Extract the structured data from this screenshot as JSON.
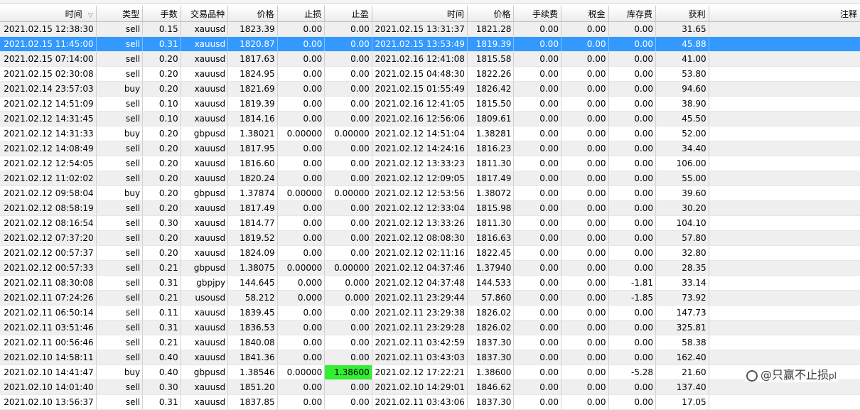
{
  "headers": {
    "open_time": "时间",
    "type": "类型",
    "volume": "手数",
    "symbol": "交易品种",
    "open_price": "价格",
    "stop_loss": "止损",
    "take_profit": "止盈",
    "close_time": "时间",
    "close_price": "价格",
    "commission": "手续费",
    "taxes": "税金",
    "swap": "库存费",
    "profit": "获利",
    "comment": "注释"
  },
  "sort_indicator": "▽",
  "selected_row": 1,
  "highlight": {
    "row": 23,
    "col": "tp",
    "color": "#33ee33"
  },
  "rows": [
    {
      "t1": "2021.02.15 12:38:30",
      "type": "sell",
      "vol": "0.15",
      "sym": "xauusd",
      "p1": "1823.39",
      "sl": "0.00",
      "tp": "0.00",
      "t2": "2021.02.15 13:31:37",
      "p2": "1821.28",
      "com": "0.00",
      "tax": "0.00",
      "swap": "0.00",
      "profit": "31.65"
    },
    {
      "t1": "2021.02.15 11:45:00",
      "type": "sell",
      "vol": "0.31",
      "sym": "xauusd",
      "p1": "1820.87",
      "sl": "0.00",
      "tp": "0.00",
      "t2": "2021.02.15 13:53:49",
      "p2": "1819.39",
      "com": "0.00",
      "tax": "0.00",
      "swap": "0.00",
      "profit": "45.88"
    },
    {
      "t1": "2021.02.15 07:14:00",
      "type": "sell",
      "vol": "0.20",
      "sym": "xauusd",
      "p1": "1817.63",
      "sl": "0.00",
      "tp": "0.00",
      "t2": "2021.02.16 12:41:08",
      "p2": "1815.58",
      "com": "0.00",
      "tax": "0.00",
      "swap": "0.00",
      "profit": "41.00"
    },
    {
      "t1": "2021.02.15 02:30:08",
      "type": "sell",
      "vol": "0.20",
      "sym": "xauusd",
      "p1": "1824.95",
      "sl": "0.00",
      "tp": "0.00",
      "t2": "2021.02.15 04:48:30",
      "p2": "1822.26",
      "com": "0.00",
      "tax": "0.00",
      "swap": "0.00",
      "profit": "53.80"
    },
    {
      "t1": "2021.02.14 23:57:03",
      "type": "buy",
      "vol": "0.20",
      "sym": "xauusd",
      "p1": "1821.69",
      "sl": "0.00",
      "tp": "0.00",
      "t2": "2021.02.15 01:55:49",
      "p2": "1826.42",
      "com": "0.00",
      "tax": "0.00",
      "swap": "0.00",
      "profit": "94.60"
    },
    {
      "t1": "2021.02.12 14:51:09",
      "type": "sell",
      "vol": "0.10",
      "sym": "xauusd",
      "p1": "1819.39",
      "sl": "0.00",
      "tp": "0.00",
      "t2": "2021.02.16 12:41:05",
      "p2": "1815.50",
      "com": "0.00",
      "tax": "0.00",
      "swap": "0.00",
      "profit": "38.90"
    },
    {
      "t1": "2021.02.12 14:31:45",
      "type": "sell",
      "vol": "0.10",
      "sym": "xauusd",
      "p1": "1814.16",
      "sl": "0.00",
      "tp": "0.00",
      "t2": "2021.02.16 12:56:06",
      "p2": "1809.61",
      "com": "0.00",
      "tax": "0.00",
      "swap": "0.00",
      "profit": "45.50"
    },
    {
      "t1": "2021.02.12 14:31:33",
      "type": "buy",
      "vol": "0.20",
      "sym": "gbpusd",
      "p1": "1.38021",
      "sl": "0.00000",
      "tp": "0.00000",
      "t2": "2021.02.12 14:51:04",
      "p2": "1.38281",
      "com": "0.00",
      "tax": "0.00",
      "swap": "0.00",
      "profit": "52.00"
    },
    {
      "t1": "2021.02.12 14:08:49",
      "type": "sell",
      "vol": "0.20",
      "sym": "xauusd",
      "p1": "1817.95",
      "sl": "0.00",
      "tp": "0.00",
      "t2": "2021.02.12 14:24:16",
      "p2": "1816.23",
      "com": "0.00",
      "tax": "0.00",
      "swap": "0.00",
      "profit": "34.40"
    },
    {
      "t1": "2021.02.12 12:54:05",
      "type": "sell",
      "vol": "0.20",
      "sym": "xauusd",
      "p1": "1816.60",
      "sl": "0.00",
      "tp": "0.00",
      "t2": "2021.02.12 13:33:23",
      "p2": "1811.30",
      "com": "0.00",
      "tax": "0.00",
      "swap": "0.00",
      "profit": "106.00"
    },
    {
      "t1": "2021.02.12 11:02:02",
      "type": "sell",
      "vol": "0.20",
      "sym": "xauusd",
      "p1": "1820.24",
      "sl": "0.00",
      "tp": "0.00",
      "t2": "2021.02.12 12:09:05",
      "p2": "1817.49",
      "com": "0.00",
      "tax": "0.00",
      "swap": "0.00",
      "profit": "55.00"
    },
    {
      "t1": "2021.02.12 09:58:04",
      "type": "buy",
      "vol": "0.20",
      "sym": "gbpusd",
      "p1": "1.37874",
      "sl": "0.00000",
      "tp": "0.00000",
      "t2": "2021.02.12 12:53:56",
      "p2": "1.38072",
      "com": "0.00",
      "tax": "0.00",
      "swap": "0.00",
      "profit": "39.60"
    },
    {
      "t1": "2021.02.12 08:58:19",
      "type": "sell",
      "vol": "0.20",
      "sym": "xauusd",
      "p1": "1817.49",
      "sl": "0.00",
      "tp": "0.00",
      "t2": "2021.02.12 12:33:04",
      "p2": "1815.98",
      "com": "0.00",
      "tax": "0.00",
      "swap": "0.00",
      "profit": "30.20"
    },
    {
      "t1": "2021.02.12 08:16:54",
      "type": "sell",
      "vol": "0.30",
      "sym": "xauusd",
      "p1": "1814.77",
      "sl": "0.00",
      "tp": "0.00",
      "t2": "2021.02.12 13:33:26",
      "p2": "1811.30",
      "com": "0.00",
      "tax": "0.00",
      "swap": "0.00",
      "profit": "104.10"
    },
    {
      "t1": "2021.02.12 07:37:20",
      "type": "sell",
      "vol": "0.20",
      "sym": "xauusd",
      "p1": "1819.52",
      "sl": "0.00",
      "tp": "0.00",
      "t2": "2021.02.12 08:08:30",
      "p2": "1816.63",
      "com": "0.00",
      "tax": "0.00",
      "swap": "0.00",
      "profit": "57.80"
    },
    {
      "t1": "2021.02.12 00:57:37",
      "type": "sell",
      "vol": "0.20",
      "sym": "xauusd",
      "p1": "1824.09",
      "sl": "0.00",
      "tp": "0.00",
      "t2": "2021.02.12 02:11:16",
      "p2": "1822.45",
      "com": "0.00",
      "tax": "0.00",
      "swap": "0.00",
      "profit": "32.80"
    },
    {
      "t1": "2021.02.12 00:57:33",
      "type": "sell",
      "vol": "0.21",
      "sym": "gbpusd",
      "p1": "1.38075",
      "sl": "0.00000",
      "tp": "0.00000",
      "t2": "2021.02.12 04:37:46",
      "p2": "1.37940",
      "com": "0.00",
      "tax": "0.00",
      "swap": "0.00",
      "profit": "28.35"
    },
    {
      "t1": "2021.02.11 08:30:08",
      "type": "sell",
      "vol": "0.31",
      "sym": "gbpjpy",
      "p1": "144.645",
      "sl": "0.000",
      "tp": "0.000",
      "t2": "2021.02.12 04:37:48",
      "p2": "144.533",
      "com": "0.00",
      "tax": "0.00",
      "swap": "-1.81",
      "profit": "33.14"
    },
    {
      "t1": "2021.02.11 07:24:26",
      "type": "sell",
      "vol": "0.21",
      "sym": "usousd",
      "p1": "58.212",
      "sl": "0.000",
      "tp": "0.000",
      "t2": "2021.02.11 23:29:44",
      "p2": "57.860",
      "com": "0.00",
      "tax": "0.00",
      "swap": "-1.85",
      "profit": "73.92"
    },
    {
      "t1": "2021.02.11 06:50:14",
      "type": "sell",
      "vol": "0.11",
      "sym": "xauusd",
      "p1": "1839.45",
      "sl": "0.00",
      "tp": "0.00",
      "t2": "2021.02.11 23:29:38",
      "p2": "1826.02",
      "com": "0.00",
      "tax": "0.00",
      "swap": "0.00",
      "profit": "147.73"
    },
    {
      "t1": "2021.02.11 03:51:46",
      "type": "sell",
      "vol": "0.31",
      "sym": "xauusd",
      "p1": "1836.53",
      "sl": "0.00",
      "tp": "0.00",
      "t2": "2021.02.11 23:29:28",
      "p2": "1826.02",
      "com": "0.00",
      "tax": "0.00",
      "swap": "0.00",
      "profit": "325.81"
    },
    {
      "t1": "2021.02.11 00:56:46",
      "type": "sell",
      "vol": "0.21",
      "sym": "xauusd",
      "p1": "1840.08",
      "sl": "0.00",
      "tp": "0.00",
      "t2": "2021.02.11 03:42:59",
      "p2": "1837.30",
      "com": "0.00",
      "tax": "0.00",
      "swap": "0.00",
      "profit": "58.38"
    },
    {
      "t1": "2021.02.10 14:58:11",
      "type": "sell",
      "vol": "0.40",
      "sym": "xauusd",
      "p1": "1841.36",
      "sl": "0.00",
      "tp": "0.00",
      "t2": "2021.02.11 03:43:03",
      "p2": "1837.30",
      "com": "0.00",
      "tax": "0.00",
      "swap": "0.00",
      "profit": "162.40"
    },
    {
      "t1": "2021.02.10 14:41:47",
      "type": "buy",
      "vol": "0.40",
      "sym": "gbpusd",
      "p1": "1.38546",
      "sl": "0.00000",
      "tp": "1.38600",
      "t2": "2021.02.12 17:22:21",
      "p2": "1.38600",
      "com": "0.00",
      "tax": "0.00",
      "swap": "-5.28",
      "profit": "21.60"
    },
    {
      "t1": "2021.02.10 14:01:40",
      "type": "sell",
      "vol": "0.30",
      "sym": "xauusd",
      "p1": "1851.20",
      "sl": "0.00",
      "tp": "0.00",
      "t2": "2021.02.10 14:29:01",
      "p2": "1846.62",
      "com": "0.00",
      "tax": "0.00",
      "swap": "0.00",
      "profit": "137.40"
    },
    {
      "t1": "2021.02.10 13:56:37",
      "type": "sell",
      "vol": "0.31",
      "sym": "xauusd",
      "p1": "1837.85",
      "sl": "0.00",
      "tp": "0.00",
      "t2": "2021.02.11 03:43:06",
      "p2": "1837.30",
      "com": "0.00",
      "tax": "0.00",
      "swap": "0.00",
      "profit": "17.05"
    }
  ],
  "watermark": {
    "text": "@只赢不止损",
    "suffix": "pl"
  }
}
